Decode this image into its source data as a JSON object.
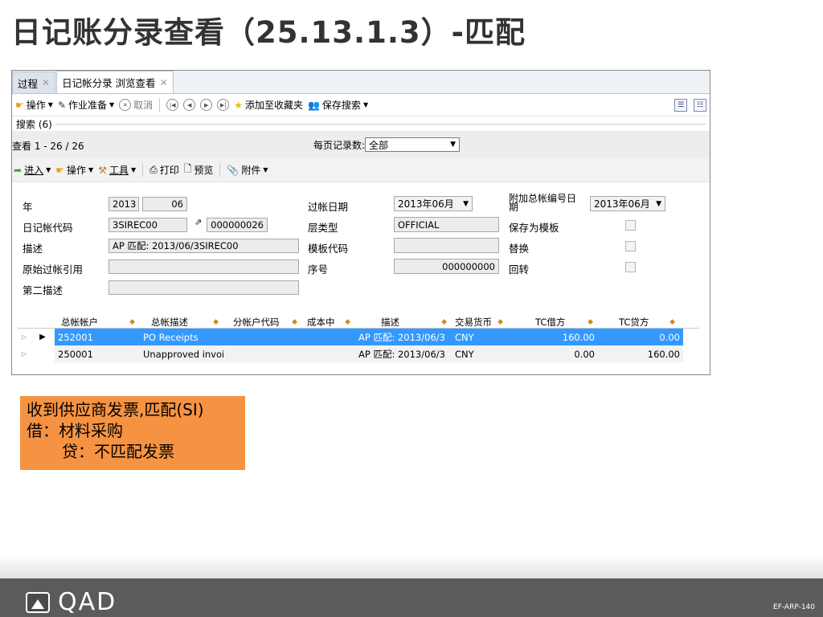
{
  "slide": {
    "title": "日记账分录查看（25.13.1.3）-匹配",
    "code": "EF-ARP-140"
  },
  "tabs": [
    {
      "label": "过程",
      "active": false
    },
    {
      "label": "日记帐分录 浏览查看",
      "active": true
    }
  ],
  "toolbar": {
    "actions": "操作",
    "prepare": "作业准备",
    "cancel": "取消",
    "add_favorite": "添加至收藏夹",
    "save_search": "保存搜索"
  },
  "search": {
    "label": "搜索 (6)"
  },
  "nav": {
    "count": "查看 1 - 26 / 26",
    "per_page_label": "每页记录数:",
    "per_page_value": "全部"
  },
  "actionbar": {
    "enter": "进入",
    "actions": "操作",
    "tools": "工具",
    "print": "打印",
    "preview": "预览",
    "attachment": "附件"
  },
  "form": {
    "year_label": "年",
    "year": "2013",
    "period": "06",
    "daybook_label": "日记帐代码",
    "daybook": "3SIREC00",
    "voucher": "000000026",
    "desc_label": "描述",
    "desc": "AP 匹配: 2013/06/3SIREC00",
    "orig_ref_label": "原始过帐引用",
    "orig_ref": "",
    "desc2_label": "第二描述",
    "desc2": "",
    "post_date_label": "过帐日期",
    "post_date": "2013年06月",
    "layer_label": "层类型",
    "layer": "OFFICIAL",
    "template_label": "模板代码",
    "template": "",
    "seq_label": "序号",
    "seq": "000000000",
    "addl_date_label": "附加总帐编号日期",
    "addl_date": "2013年06月",
    "save_tmpl_label": "保存为模板",
    "replace_label": "替换",
    "reverse_label": "回转"
  },
  "grid": {
    "columns": [
      "总帐帐户",
      "总帐描述",
      "分帐户代码",
      "成本中",
      "描述",
      "交易货币",
      "TC借方",
      "TC贷方"
    ],
    "rows": [
      [
        "252001",
        "PO Receipts",
        "",
        "",
        "AP 匹配: 2013/06/3",
        "CNY",
        "160.00",
        "0.00"
      ],
      [
        "250001",
        "Unapproved invoic",
        "",
        "",
        "AP 匹配: 2013/06/3",
        "CNY",
        "0.00",
        "160.00"
      ]
    ]
  },
  "note": {
    "line1": "收到供应商发票,匹配(SI)",
    "line2": "借：材料采购",
    "line3": "贷：不匹配发票"
  },
  "brand": {
    "logo_text": "QAD"
  },
  "colors": {
    "selection": "#3399ff",
    "note_bg": "#f59342",
    "footer_bg": "#5b5b5b"
  }
}
